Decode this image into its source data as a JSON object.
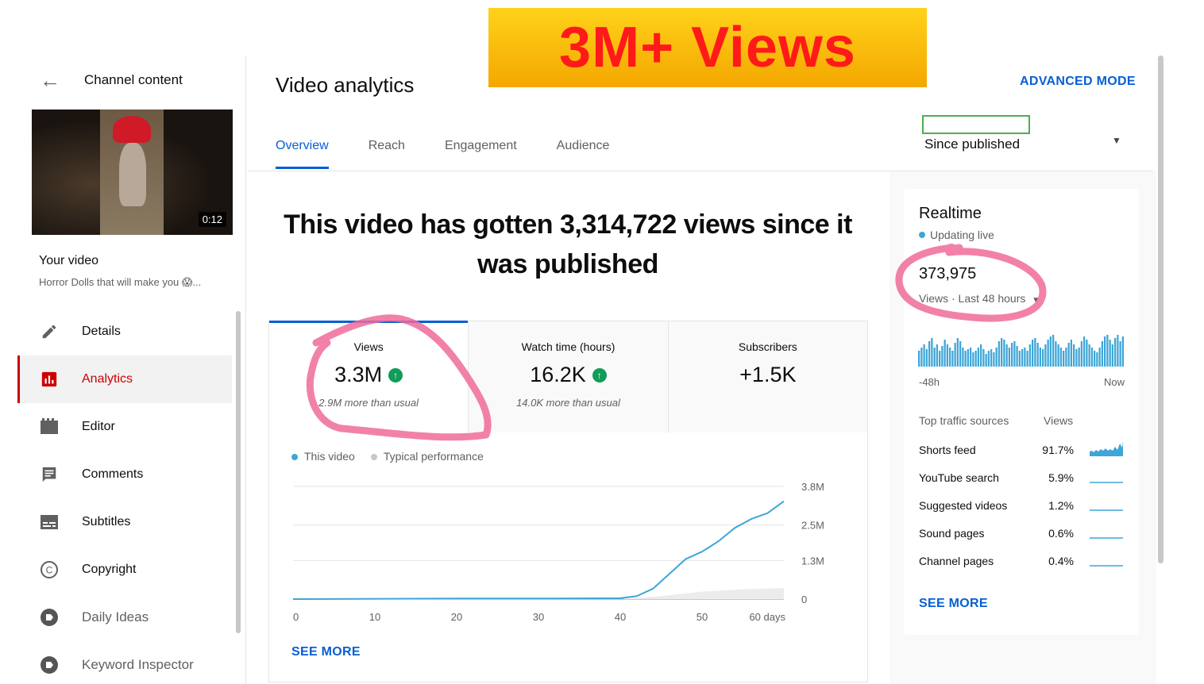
{
  "banner": {
    "text": "3M+ Views"
  },
  "sidebar": {
    "back_label": "Channel content",
    "thumbnail_duration": "0:12",
    "your_video": "Your video",
    "video_title": "Horror Dolls that will make you 😱...",
    "items": [
      {
        "label": "Details",
        "icon": "pencil-icon"
      },
      {
        "label": "Analytics",
        "icon": "analytics-icon",
        "active": true
      },
      {
        "label": "Editor",
        "icon": "film-icon"
      },
      {
        "label": "Comments",
        "icon": "comment-icon"
      },
      {
        "label": "Subtitles",
        "icon": "subtitles-icon"
      },
      {
        "label": "Copyright",
        "icon": "copyright-icon"
      },
      {
        "label": "Daily Ideas",
        "icon": "extension-icon"
      },
      {
        "label": "Keyword Inspector",
        "icon": "extension-icon"
      }
    ]
  },
  "header": {
    "title": "Video analytics",
    "advanced_mode": "ADVANCED MODE",
    "tabs": [
      "Overview",
      "Reach",
      "Engagement",
      "Audience"
    ],
    "date_range": "Since published"
  },
  "headline": "This video has gotten 3,314,722 views since it was published",
  "metrics": [
    {
      "label": "Views",
      "value": "3.3M",
      "sub": "2.9M more than usual",
      "trend_up": true
    },
    {
      "label": "Watch time (hours)",
      "value": "16.2K",
      "sub": "14.0K more than usual",
      "trend_up": true
    },
    {
      "label": "Subscribers",
      "value": "+1.5K",
      "sub": ""
    }
  ],
  "chart_legend": {
    "series_this": "This video",
    "series_typical": "Typical performance"
  },
  "chart_data": {
    "type": "line",
    "x_ticks": [
      "0",
      "10",
      "20",
      "30",
      "40",
      "50",
      "60 days"
    ],
    "y_ticks": [
      "3.8M",
      "2.5M",
      "1.3M",
      "0"
    ],
    "xlim": [
      0,
      60
    ],
    "ylim": [
      0,
      3.8
    ],
    "y_unit": "M",
    "series": [
      {
        "name": "This video",
        "color": "#3ea6d8",
        "x": [
          0,
          20,
          30,
          40,
          42,
          44,
          46,
          48,
          50,
          52,
          54,
          56,
          58,
          60
        ],
        "y": [
          0,
          0.02,
          0.02,
          0.03,
          0.1,
          0.35,
          0.85,
          1.35,
          1.6,
          1.95,
          2.4,
          2.7,
          2.9,
          3.3
        ]
      },
      {
        "name": "Typical performance",
        "color": "#d9d9d9",
        "x": [
          40,
          45,
          50,
          55,
          60
        ],
        "y": [
          0,
          0.1,
          0.25,
          0.33,
          0.37
        ]
      }
    ]
  },
  "see_more": "SEE MORE",
  "realtime": {
    "title": "Realtime",
    "updating": "Updating live",
    "count": "373,975",
    "subtitle": "Views · Last 48 hours",
    "axis_left": "-48h",
    "axis_right": "Now",
    "bars": [
      0.5,
      0.6,
      0.7,
      0.55,
      0.8,
      0.9,
      0.6,
      0.7,
      0.5,
      0.65,
      0.85,
      0.7,
      0.6,
      0.5,
      0.75,
      0.9,
      0.8,
      0.6,
      0.5,
      0.55,
      0.6,
      0.45,
      0.5,
      0.6,
      0.7,
      0.55,
      0.4,
      0.5,
      0.55,
      0.45,
      0.6,
      0.8,
      0.9,
      0.85,
      0.7,
      0.6,
      0.75,
      0.8,
      0.65,
      0.5,
      0.55,
      0.6,
      0.5,
      0.7,
      0.85,
      0.9,
      0.75,
      0.6,
      0.55,
      0.7,
      0.85,
      0.95,
      1.0,
      0.8,
      0.7,
      0.6,
      0.5,
      0.6,
      0.75,
      0.85,
      0.7,
      0.55,
      0.6,
      0.8,
      0.95,
      0.85,
      0.7,
      0.6,
      0.5,
      0.45,
      0.6,
      0.8,
      0.95,
      1.0,
      0.85,
      0.7,
      0.9,
      1.0,
      0.8,
      0.95
    ],
    "bar_color": "#3ea6d8",
    "traffic_header": {
      "label": "Top traffic sources",
      "views": "Views"
    },
    "traffic": [
      {
        "name": "Shorts feed",
        "pct": "91.7%"
      },
      {
        "name": "YouTube search",
        "pct": "5.9%"
      },
      {
        "name": "Suggested videos",
        "pct": "1.2%"
      },
      {
        "name": "Sound pages",
        "pct": "0.6%"
      },
      {
        "name": "Channel pages",
        "pct": "0.4%"
      }
    ],
    "see_more": "SEE MORE"
  },
  "colors": {
    "accent": "#065fd4",
    "active": "#cc0000",
    "annotation": "#f06b9a"
  }
}
